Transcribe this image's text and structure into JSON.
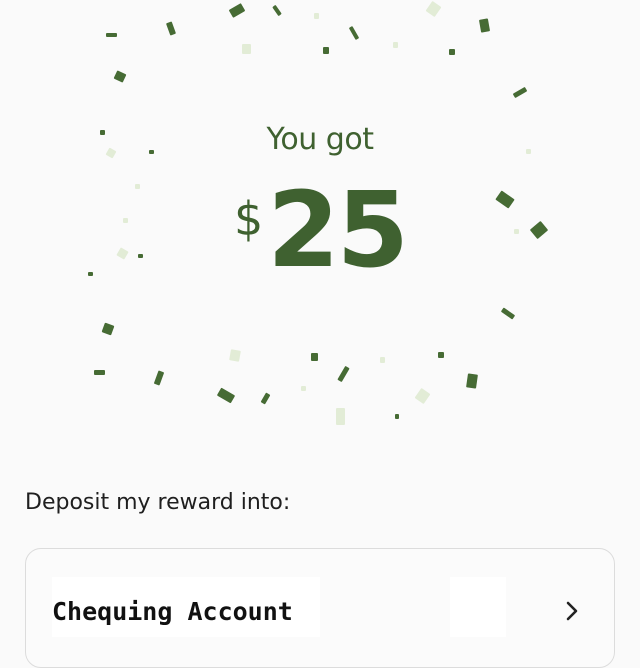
{
  "reward": {
    "heading": "You got",
    "currency_symbol": "$",
    "amount": "25"
  },
  "deposit": {
    "prompt": "Deposit my reward into:",
    "account": {
      "name": "Chequing Account",
      "chevron_icon": "chevron-right-icon"
    }
  },
  "colors": {
    "brand_green": "#3f6130",
    "confetti_dark": "#466b34",
    "confetti_light": "#e2ecd6",
    "background": "#fafafa"
  }
}
